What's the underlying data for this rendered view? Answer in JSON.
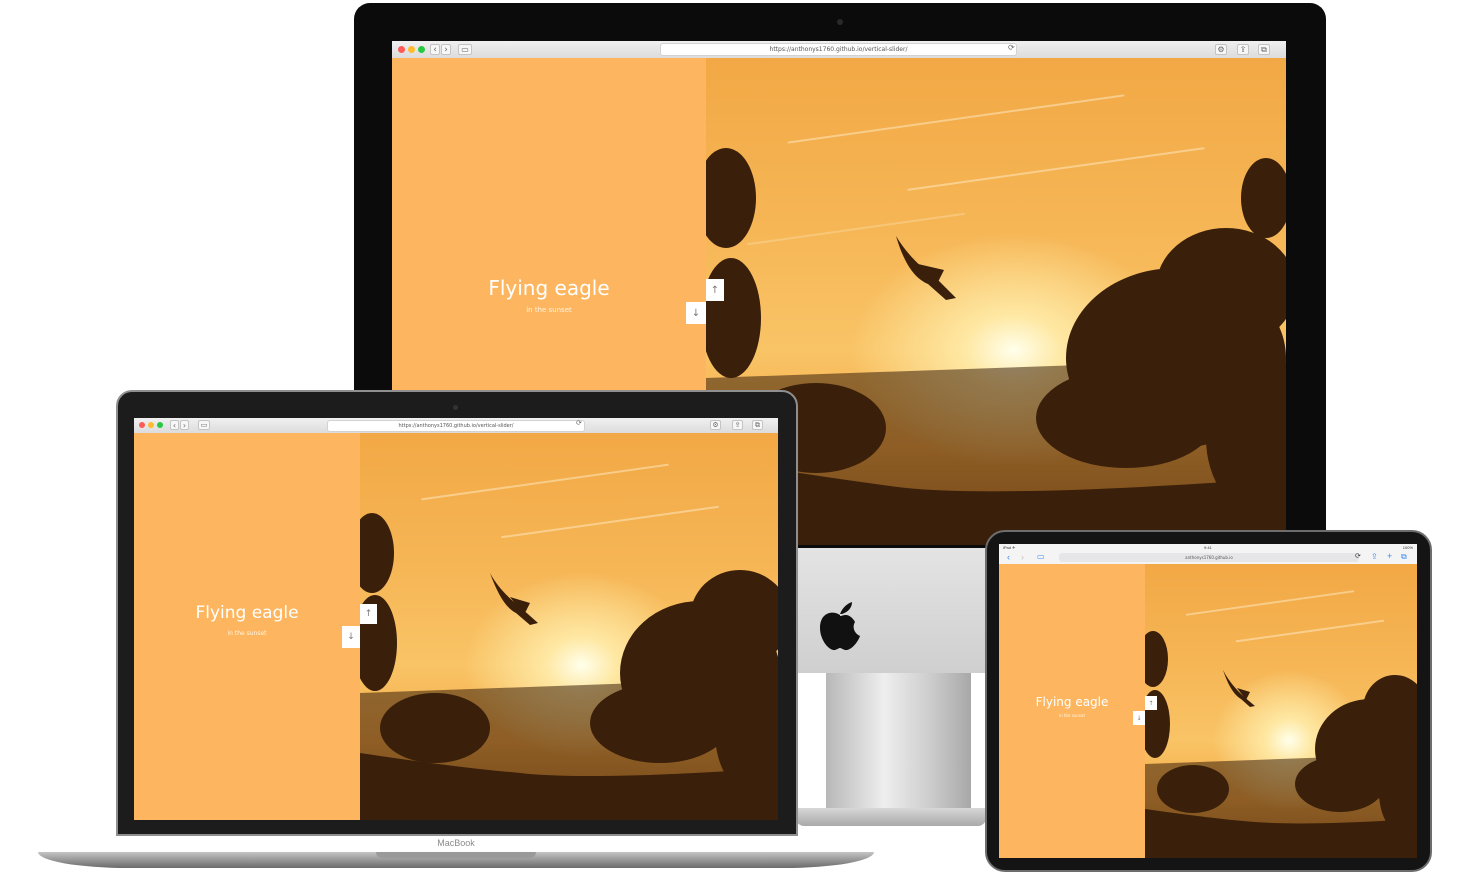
{
  "slide": {
    "title": "Flying eagle",
    "subtitle": "in the sunset"
  },
  "navigation": {
    "up_icon": "↑",
    "down_icon": "↓"
  },
  "browser": {
    "desktop_url": "https://anthonys1760.github.io/vertical-slider/",
    "laptop_url": "https://anthonys1760.github.io/vertical-slider/",
    "tablet_url": "anthonys1760.github.io",
    "tablet_status_left": "iPad ✈",
    "tablet_status_time": "9:41",
    "tablet_status_right": "100%"
  },
  "devices": {
    "laptop_brand": "MacBook"
  },
  "icons": {
    "apple_logo": "apple-logo-icon",
    "reload": "⟳",
    "back": "‹",
    "forward": "›",
    "sidebar": "▭",
    "share": "⇪",
    "tabs": "⧉",
    "settings": "⚙"
  },
  "colors": {
    "panel": "#fdb65f",
    "close_dot": "#fc5b57",
    "minimize_dot": "#fcbc2e",
    "zoom_dot": "#28c840"
  }
}
